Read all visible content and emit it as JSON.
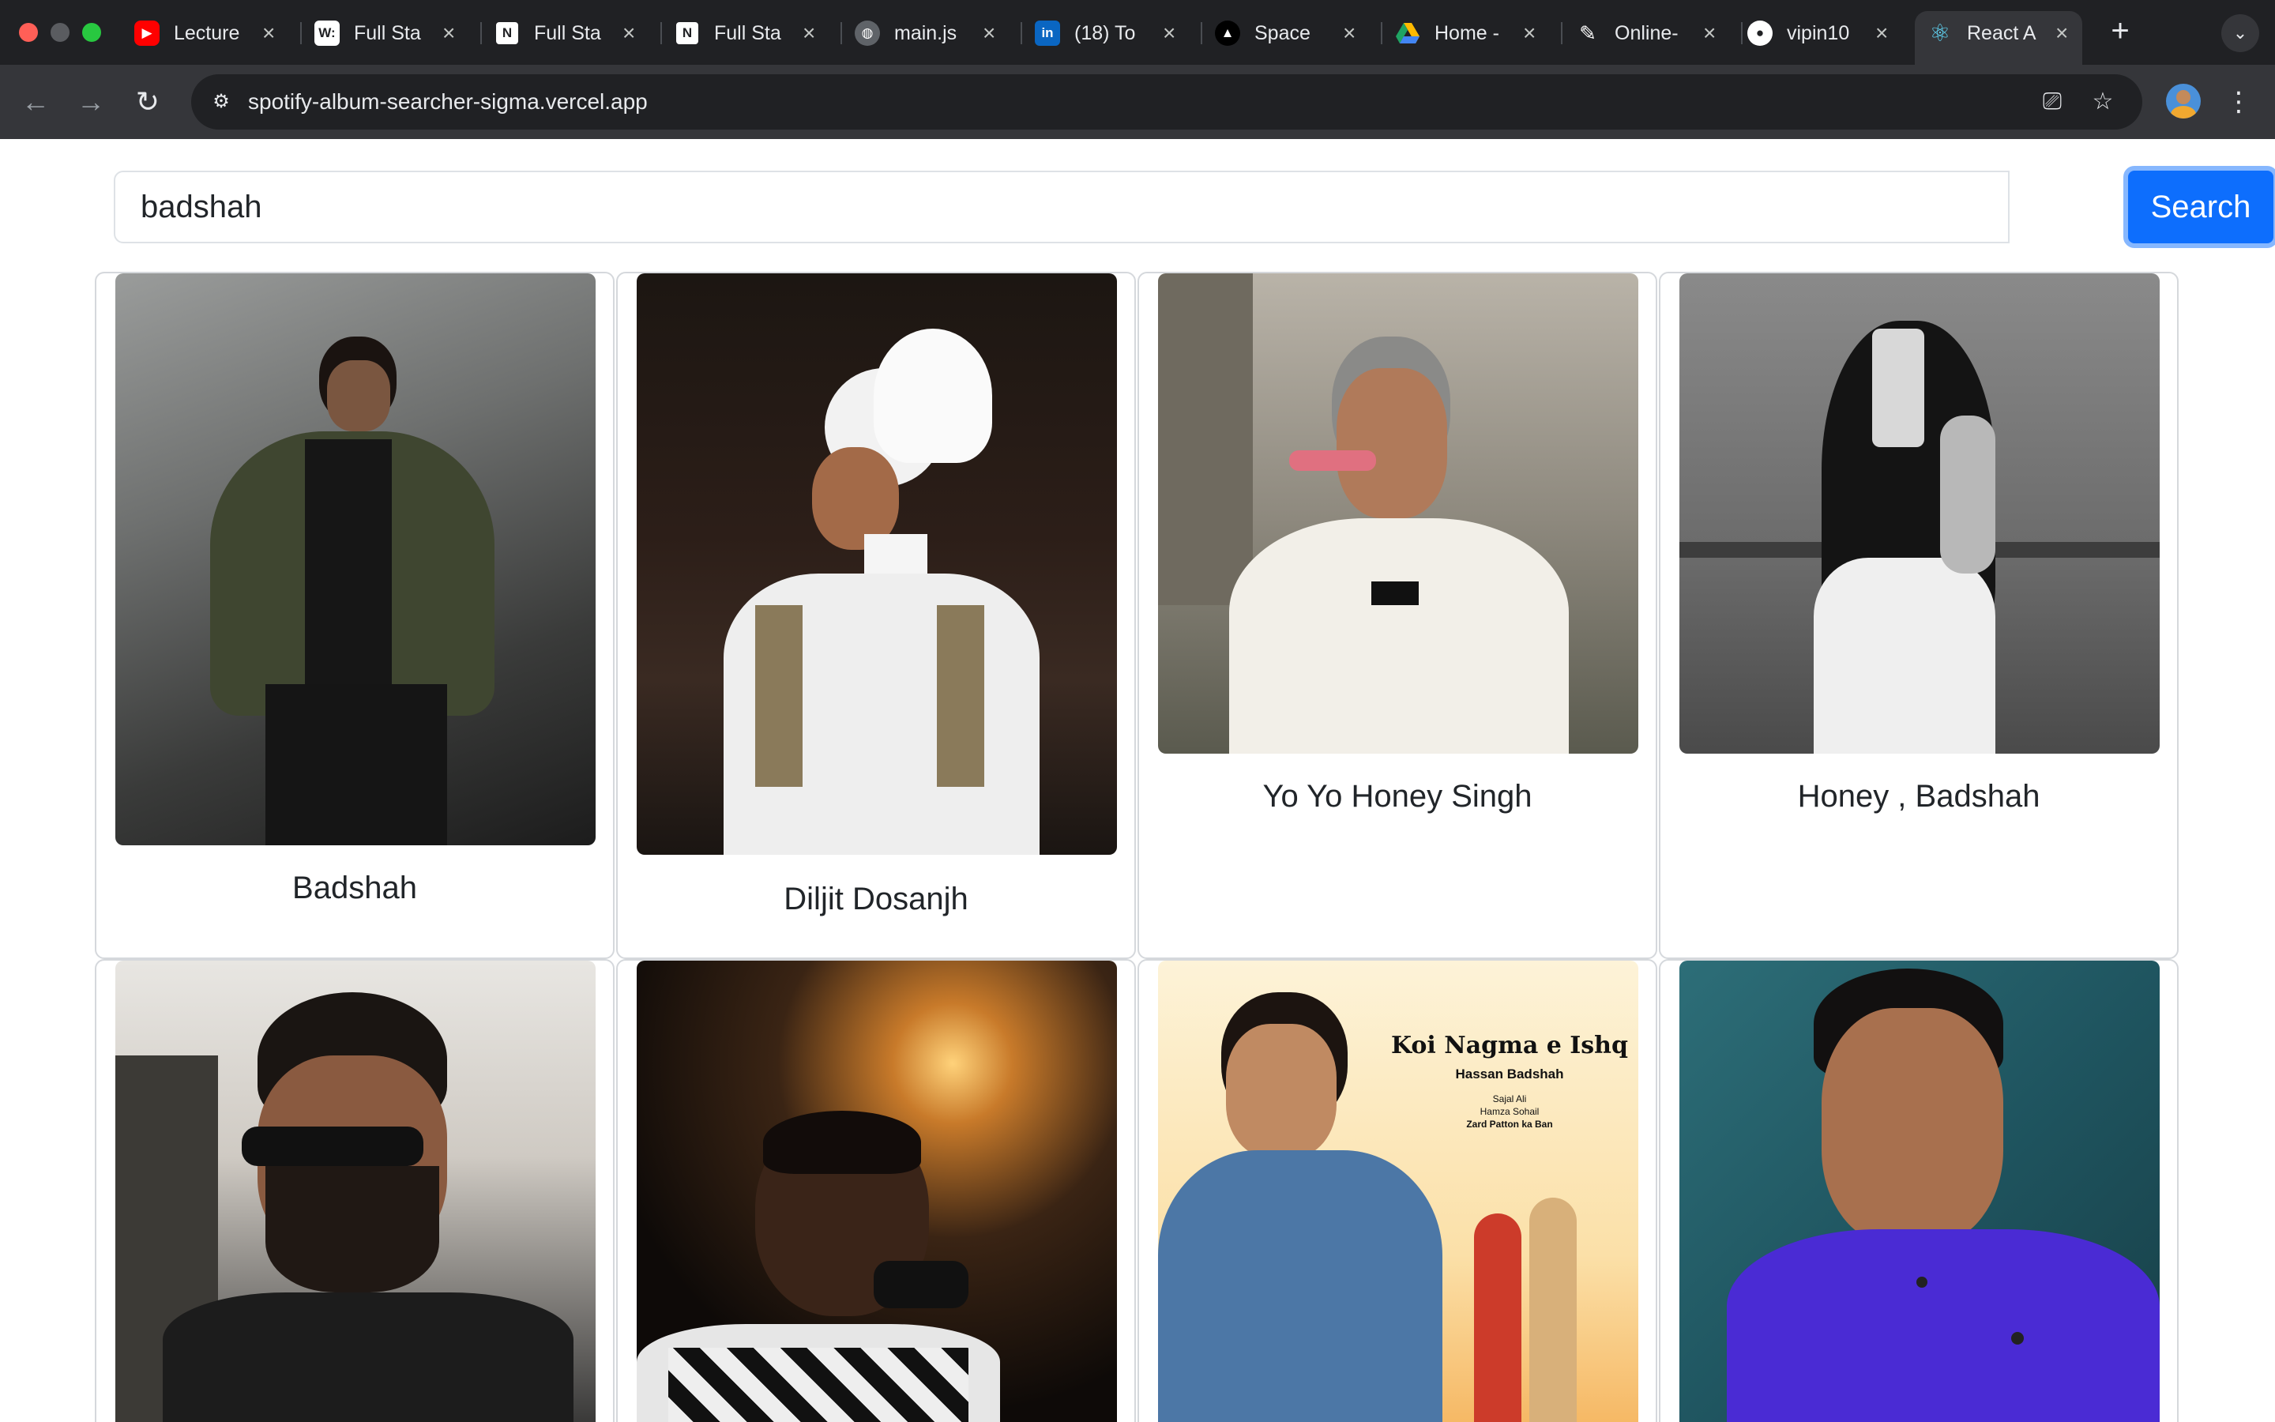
{
  "browser": {
    "tabs": [
      {
        "title": "Lecture",
        "icon": "youtube-icon",
        "color": "#ff0000"
      },
      {
        "title": "Full Sta",
        "icon": "w-letter-icon",
        "color": "#ffffff"
      },
      {
        "title": "Full Sta",
        "icon": "notion-icon",
        "color": "#ffffff"
      },
      {
        "title": "Full Sta",
        "icon": "notion-icon",
        "color": "#ffffff"
      },
      {
        "title": "main.js",
        "icon": "globe-icon",
        "color": "#9aa0a6"
      },
      {
        "title": "(18) To",
        "icon": "linkedin-icon",
        "color": "#0a66c2"
      },
      {
        "title": "Space",
        "icon": "triangle-logo-icon",
        "color": "#ffffff"
      },
      {
        "title": "Home -",
        "icon": "google-drive-icon",
        "color": "#1fa463"
      },
      {
        "title": "Online-",
        "icon": "pen-tool-icon",
        "color": "#ffffff"
      },
      {
        "title": "vipin10",
        "icon": "github-icon",
        "color": "#ffffff"
      },
      {
        "title": "React A",
        "icon": "react-icon",
        "color": "#61dafb"
      }
    ],
    "address": "spotify-album-searcher-sigma.vercel.app"
  },
  "search": {
    "value": "badshah",
    "button_label": "Search"
  },
  "artists": [
    {
      "name": "Badshah"
    },
    {
      "name": "Diljit Dosanjh"
    },
    {
      "name": "Yo Yo Honey Singh"
    },
    {
      "name": "Honey , Badshah"
    },
    {
      "name": ""
    },
    {
      "name": ""
    },
    {
      "name": ""
    },
    {
      "name": ""
    }
  ],
  "poster": {
    "title": "Koi Nagma e Ishq",
    "subtitle": "Hassan Badshah",
    "credit1": "Sajal Ali",
    "credit2": "Hamza Sohail",
    "credit3": "Zard Patton ka Ban"
  },
  "colors": {
    "accent": "#0d6efd",
    "chrome_dark": "#202124",
    "chrome_toolbar": "#35363a"
  }
}
